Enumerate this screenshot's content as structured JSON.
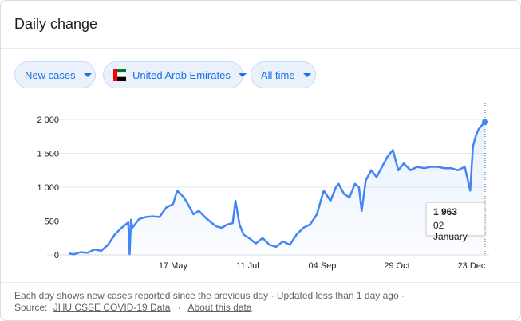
{
  "title": "Daily change",
  "chips": {
    "metric": "New cases",
    "country": "United Arab Emirates",
    "range": "All time"
  },
  "tooltip": {
    "value": "1 963",
    "date": "02 January"
  },
  "footer": {
    "line1": "Each day shows new cases reported since the previous day · Updated less than 1 day ago ·",
    "source_label": "Source:",
    "source_link": "JHU CSSE COVID-19 Data",
    "sep": "·",
    "about_link": "About this data"
  },
  "colors": {
    "line": "#4285f4",
    "chip_bg": "#eaf1fb",
    "chip_text": "#1a73e8",
    "grid": "#e8eaed"
  },
  "chart_data": {
    "type": "line",
    "title": "",
    "xlabel": "",
    "ylabel": "",
    "ylim": [
      0,
      2000
    ],
    "yticks": [
      0,
      500,
      1000,
      1500,
      2000
    ],
    "ytick_labels": [
      "0",
      "500",
      "1 000",
      "1 500",
      "2 000"
    ],
    "xtick_labels": [
      "17 May",
      "11 Jul",
      "04 Sep",
      "29 Oct",
      "23 Dec"
    ],
    "xticks": [
      "2020-05-17",
      "2020-07-11",
      "2020-09-04",
      "2020-10-29",
      "2020-12-23"
    ],
    "grid": true,
    "series": [
      {
        "x": [
          "2020-03-01",
          "2020-03-05",
          "2020-03-10",
          "2020-03-15",
          "2020-03-20",
          "2020-03-25",
          "2020-03-30",
          "2020-04-04",
          "2020-04-09",
          "2020-04-14",
          "2020-04-15",
          "2020-04-16",
          "2020-04-17",
          "2020-04-22",
          "2020-04-27",
          "2020-05-02",
          "2020-05-07",
          "2020-05-12",
          "2020-05-17",
          "2020-05-20",
          "2020-05-25",
          "2020-05-28",
          "2020-06-01",
          "2020-06-05",
          "2020-06-10",
          "2020-06-14",
          "2020-06-18",
          "2020-06-22",
          "2020-06-26",
          "2020-06-30",
          "2020-07-02",
          "2020-07-05",
          "2020-07-08",
          "2020-07-12",
          "2020-07-17",
          "2020-07-22",
          "2020-07-27",
          "2020-08-01",
          "2020-08-06",
          "2020-08-11",
          "2020-08-16",
          "2020-08-21",
          "2020-08-26",
          "2020-08-31",
          "2020-09-05",
          "2020-09-10",
          "2020-09-14",
          "2020-09-16",
          "2020-09-20",
          "2020-09-24",
          "2020-09-28",
          "2020-10-01",
          "2020-10-03",
          "2020-10-06",
          "2020-10-10",
          "2020-10-14",
          "2020-10-18",
          "2020-10-22",
          "2020-10-26",
          "2020-10-30",
          "2020-11-03",
          "2020-11-08",
          "2020-11-13",
          "2020-11-18",
          "2020-11-23",
          "2020-11-28",
          "2020-12-03",
          "2020-12-08",
          "2020-12-13",
          "2020-12-18",
          "2020-12-22",
          "2020-12-24",
          "2020-12-26",
          "2020-12-28",
          "2020-12-30",
          "2021-01-02"
        ],
        "y": [
          20,
          10,
          40,
          30,
          80,
          60,
          150,
          300,
          400,
          480,
          10,
          520,
          400,
          530,
          560,
          570,
          560,
          700,
          750,
          950,
          850,
          750,
          600,
          650,
          550,
          480,
          420,
          400,
          450,
          470,
          800,
          450,
          300,
          250,
          170,
          250,
          150,
          120,
          200,
          150,
          300,
          400,
          450,
          600,
          950,
          800,
          1000,
          1050,
          900,
          850,
          1050,
          1000,
          650,
          1100,
          1250,
          1150,
          1300,
          1450,
          1550,
          1250,
          1350,
          1250,
          1300,
          1280,
          1300,
          1300,
          1280,
          1280,
          1250,
          1300,
          950,
          1600,
          1750,
          1850,
          1900,
          1963
        ]
      }
    ]
  }
}
